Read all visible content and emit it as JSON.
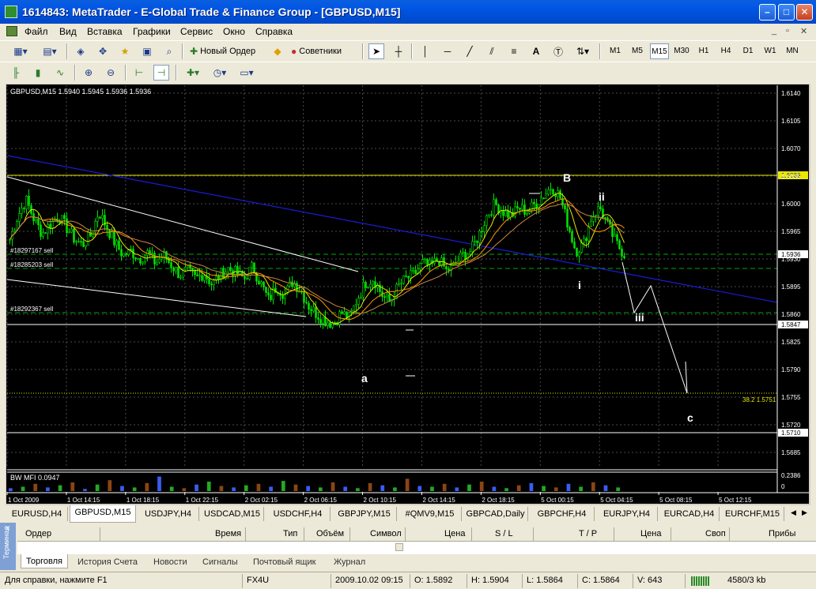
{
  "window": {
    "title": "1614843: MetaTrader - E-Global Trade & Finance Group - [GBPUSD,M15]"
  },
  "menu": [
    "Файл",
    "Вид",
    "Вставка",
    "Графики",
    "Сервис",
    "Окно",
    "Справка"
  ],
  "toolbar": {
    "new_order_label": "Новый Ордер",
    "experts_label": "Советники",
    "timeframes": [
      "M1",
      "M5",
      "M15",
      "M30",
      "H1",
      "H4",
      "D1",
      "W1",
      "MN"
    ],
    "selected_timeframe": "M15"
  },
  "chart_data": {
    "type": "candlestick",
    "symbol_header": "GBPUSD,M15  1.5940 1.5945 1.5936 1.5936",
    "ylim": [
      1.5668,
      1.615
    ],
    "y_ticks": [
      "1.6140",
      "1.6105",
      "1.6070",
      "1.6035",
      "1.6000",
      "1.5965",
      "1.5930",
      "1.5895",
      "1.5860",
      "1.5825",
      "1.5790",
      "1.5755",
      "1.5720",
      "1.5685"
    ],
    "x_ticks": [
      "1 Oct 2009",
      "1 Oct 14:15",
      "1 Oct 18:15",
      "1 Oct 22:15",
      "2 Oct 02:15",
      "2 Oct 06:15",
      "2 Oct 10:15",
      "2 Oct 14:15",
      "2 Oct 18:15",
      "5 Oct 00:15",
      "5 Oct 04:15",
      "5 Oct 08:15",
      "5 Oct 12:15"
    ],
    "close_path": [
      1.5955,
      1.5985,
      1.6005,
      1.598,
      1.5962,
      1.5975,
      1.5985,
      1.597,
      1.5955,
      1.5948,
      1.596,
      1.599,
      1.597,
      1.595,
      1.5935,
      1.594,
      1.593,
      1.5938,
      1.5925,
      1.5935,
      1.5922,
      1.591,
      1.5915,
      1.5905,
      1.5912,
      1.5898,
      1.591,
      1.5918,
      1.5912,
      1.5905,
      1.592,
      1.59,
      1.5878,
      1.5895,
      1.5885,
      1.5902,
      1.589,
      1.587,
      1.586,
      1.5852,
      1.5848,
      1.5862,
      1.5855,
      1.588,
      1.59,
      1.5905,
      1.5885,
      1.5875,
      1.5895,
      1.5905,
      1.591,
      1.5925,
      1.592,
      1.593,
      1.5915,
      1.5922,
      1.5935,
      1.594,
      1.596,
      1.5985,
      1.6,
      1.599,
      1.5985,
      1.5995,
      1.599,
      1.6,
      1.601,
      1.6022,
      1.601,
      1.5975,
      1.594,
      1.595,
      1.5985,
      1.5995,
      1.5972,
      1.595,
      1.5936
    ],
    "hlines": [
      {
        "price": 1.6036,
        "color": "#e8e800",
        "label": "1.6036",
        "style": "solid"
      },
      {
        "price": 1.5847,
        "color": "#ffffff",
        "label": "1.5847",
        "style": "solid"
      },
      {
        "price": 1.571,
        "color": "#ffffff",
        "label": "1.5710",
        "style": "solid"
      },
      {
        "price": 1.5936,
        "color": "#00aa00",
        "label": "1.5936",
        "style": "dash"
      },
      {
        "price": 1.5918,
        "color": "#00aa00",
        "label": "",
        "style": "dash"
      },
      {
        "price": 1.5862,
        "color": "#00aa00",
        "label": "",
        "style": "dash"
      },
      {
        "price": 1.576,
        "color": "#e8e800",
        "label": "",
        "style": "dot"
      }
    ],
    "order_labels": [
      {
        "text": "#18297167 sell",
        "price": 1.5936
      },
      {
        "text": "#18285203 sell",
        "price": 1.5918
      },
      {
        "text": "#18292367 sell",
        "price": 1.5862
      }
    ],
    "fib_label": "38.2  1.5751",
    "wave_labels": [
      "a",
      "B",
      "i",
      "ii",
      "iii",
      "c"
    ],
    "indicator": {
      "name": "BW MFI 0.0947",
      "scale_labels": [
        "0.2386",
        "0"
      ],
      "bars": [
        0.04,
        0.06,
        0.1,
        0.05,
        0.08,
        0.12,
        0.03,
        0.09,
        0.15,
        0.07,
        0.05,
        0.11,
        0.2,
        0.06,
        0.04,
        0.09,
        0.13,
        0.07,
        0.05,
        0.08,
        0.1,
        0.06,
        0.14,
        0.09,
        0.07,
        0.05,
        0.12,
        0.06,
        0.04,
        0.11,
        0.08,
        0.05,
        0.17,
        0.07,
        0.06,
        0.1,
        0.05,
        0.09,
        0.13,
        0.06,
        0.04,
        0.08,
        0.11,
        0.07,
        0.05,
        0.1,
        0.06,
        0.12,
        0.08,
        0.05
      ]
    },
    "colors": {
      "background": "#000000",
      "bull": "#00e000",
      "bear": "#00e000",
      "grid": "#4a4a4a",
      "trend_blue": "#1b1bd8",
      "trend_white": "#ffffff"
    }
  },
  "symbol_tabs": [
    "EURUSD,H4",
    "GBPUSD,M15",
    "USDJPY,H4",
    "USDCAD,M15",
    "USDCHF,H4",
    "GBPJPY,M15",
    "#QMV9,M15",
    "GBPCAD,Daily",
    "GBPCHF,H4",
    "EURJPY,H4",
    "EURCAD,H4",
    "EURCHF,M15"
  ],
  "selected_symbol_tab": "GBPUSD,M15",
  "terminal": {
    "side_label": "Терминал",
    "columns": [
      "Ордер",
      "Время",
      "Тип",
      "Объём",
      "Символ",
      "Цена",
      "S / L",
      "T / P",
      "Цена",
      "Своп",
      "Прибы"
    ],
    "tabs": [
      "Торговля",
      "История Счета",
      "Новости",
      "Сигналы",
      "Почтовый ящик",
      "Журнал"
    ],
    "selected_tab": "Торговля"
  },
  "statusbar": {
    "help": "Для справки, нажмите F1",
    "profile": "FX4U",
    "datetime": "2009.10.02 09:15",
    "open": "O: 1.5892",
    "high": "H: 1.5904",
    "low": "L: 1.5864",
    "close": "C: 1.5864",
    "volume": "V: 643",
    "traffic": "4580/3 kb"
  }
}
